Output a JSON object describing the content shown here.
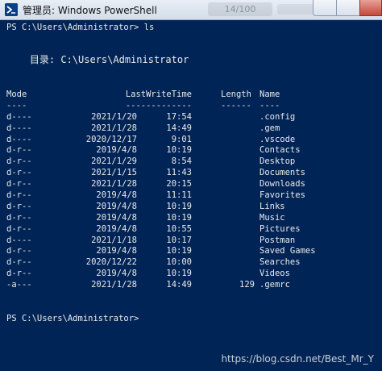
{
  "window": {
    "title": "管理员: Windows PowerShell",
    "faded_label": "14/100"
  },
  "console": {
    "command_line": "PS C:\\Users\\Administrator> ls",
    "directory_line": "    目录: C:\\Users\\Administrator",
    "headers": {
      "mode": "Mode",
      "lastwrite": "LastWriteTime",
      "length": "Length",
      "name": "Name"
    },
    "separators": {
      "mode": "----",
      "lastwrite": "-------------",
      "length": "------",
      "name": "----"
    },
    "rows": [
      {
        "mode": "d----",
        "date": "2021/1/20",
        "time": "17:54",
        "length": "",
        "name": ".config"
      },
      {
        "mode": "d----",
        "date": "2021/1/28",
        "time": "14:49",
        "length": "",
        "name": ".gem"
      },
      {
        "mode": "d----",
        "date": "2020/12/17",
        "time": "9:01",
        "length": "",
        "name": ".vscode"
      },
      {
        "mode": "d-r--",
        "date": "2019/4/8",
        "time": "10:19",
        "length": "",
        "name": "Contacts"
      },
      {
        "mode": "d-r--",
        "date": "2021/1/29",
        "time": "8:54",
        "length": "",
        "name": "Desktop"
      },
      {
        "mode": "d-r--",
        "date": "2021/1/15",
        "time": "11:43",
        "length": "",
        "name": "Documents"
      },
      {
        "mode": "d-r--",
        "date": "2021/1/28",
        "time": "20:15",
        "length": "",
        "name": "Downloads"
      },
      {
        "mode": "d-r--",
        "date": "2019/4/8",
        "time": "11:11",
        "length": "",
        "name": "Favorites"
      },
      {
        "mode": "d-r--",
        "date": "2019/4/8",
        "time": "10:19",
        "length": "",
        "name": "Links"
      },
      {
        "mode": "d-r--",
        "date": "2019/4/8",
        "time": "10:19",
        "length": "",
        "name": "Music"
      },
      {
        "mode": "d-r--",
        "date": "2019/4/8",
        "time": "10:55",
        "length": "",
        "name": "Pictures"
      },
      {
        "mode": "d----",
        "date": "2021/1/18",
        "time": "10:17",
        "length": "",
        "name": "Postman"
      },
      {
        "mode": "d-r--",
        "date": "2019/4/8",
        "time": "10:19",
        "length": "",
        "name": "Saved Games"
      },
      {
        "mode": "d-r--",
        "date": "2020/12/22",
        "time": "10:00",
        "length": "",
        "name": "Searches"
      },
      {
        "mode": "d-r--",
        "date": "2019/4/8",
        "time": "10:19",
        "length": "",
        "name": "Videos"
      },
      {
        "mode": "-a---",
        "date": "2021/1/28",
        "time": "14:49",
        "length": "129",
        "name": ".gemrc"
      }
    ],
    "prompt_line": "PS C:\\Users\\Administrator>"
  },
  "watermark": "https://blog.csdn.net/Best_Mr_Y",
  "colors": {
    "background": "#012456",
    "text": "#eaeaea"
  },
  "icons": {
    "app": "powershell-icon"
  }
}
